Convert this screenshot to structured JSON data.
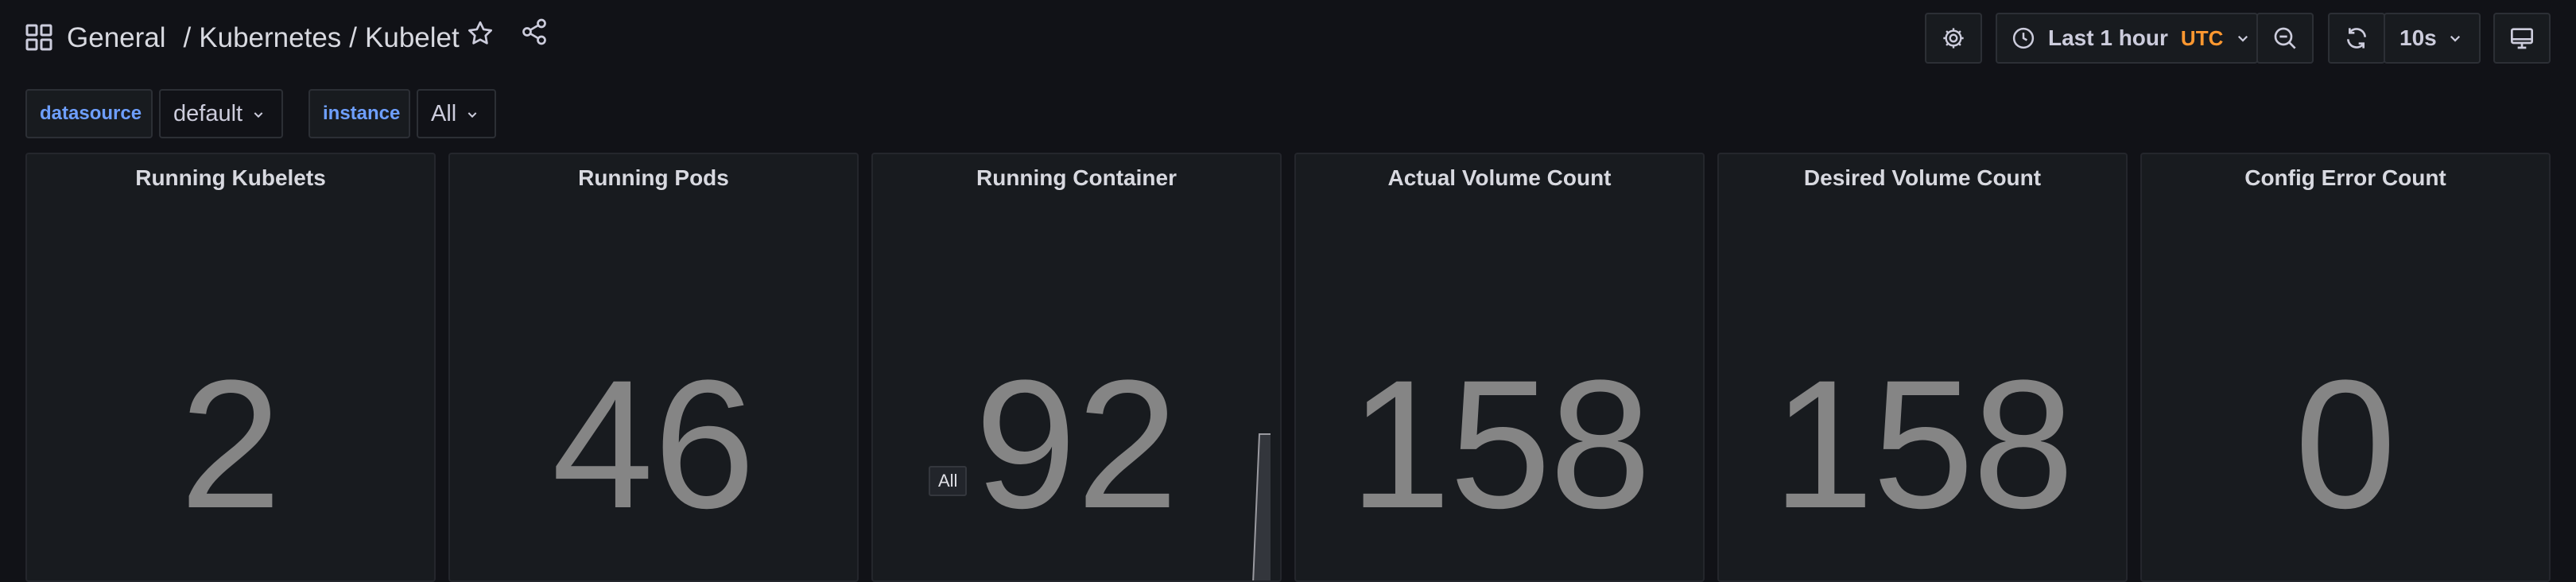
{
  "header": {
    "breadcrumb": [
      "General",
      "Kubernetes",
      "Kubelet"
    ],
    "time_range": "Last 1 hour",
    "timezone": "UTC",
    "refresh_interval": "10s",
    "icons": [
      "apps-icon",
      "star-icon",
      "share-icon",
      "settings-icon",
      "clock-icon",
      "chevron-down-icon",
      "zoom-out-icon",
      "refresh-icon",
      "tv-icon"
    ]
  },
  "variables": [
    {
      "label": "datasource",
      "value": "default"
    },
    {
      "label": "instance",
      "value": "All"
    }
  ],
  "panels": [
    {
      "title": "Running Kubelets",
      "value": "2"
    },
    {
      "title": "Running Pods",
      "value": "46"
    },
    {
      "title": "Running Container",
      "value": "92",
      "tooltip": "All"
    },
    {
      "title": "Actual Volume Count",
      "value": "158"
    },
    {
      "title": "Desired Volume Count",
      "value": "158"
    },
    {
      "title": "Config Error Count",
      "value": "0"
    }
  ],
  "colors": {
    "background": "#111217",
    "panel": "#181b1f",
    "accent": "#6e9fff",
    "timezone": "#ff9830",
    "stat_value": "#858585"
  }
}
